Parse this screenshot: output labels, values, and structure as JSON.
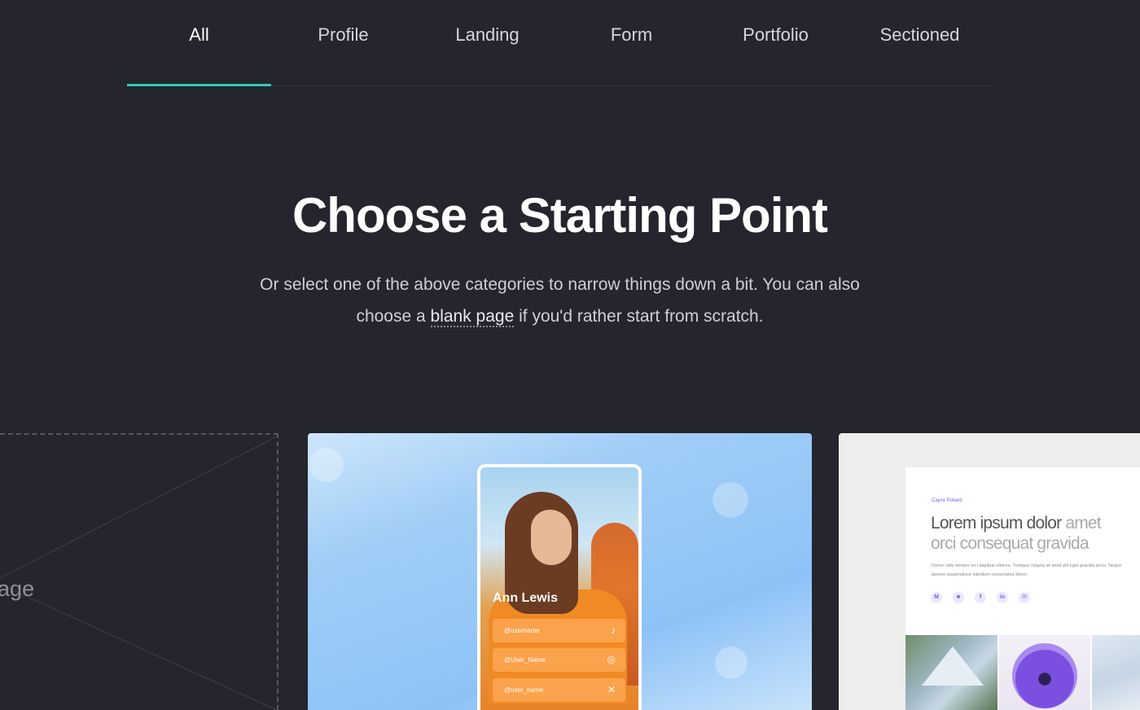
{
  "tabs": [
    {
      "label": "All",
      "active": true
    },
    {
      "label": "Profile",
      "active": false
    },
    {
      "label": "Landing",
      "active": false
    },
    {
      "label": "Form",
      "active": false
    },
    {
      "label": "Portfolio",
      "active": false
    },
    {
      "label": "Sectioned",
      "active": false
    }
  ],
  "accent_color": "#35c7b8",
  "hero": {
    "title": "Choose a Starting Point",
    "subtitle_before": "Or select one of the above categories to narrow things down a bit. You can also choose a ",
    "link_text": "blank page",
    "subtitle_after": " if you'd rather start from scratch."
  },
  "cards": {
    "blank": {
      "label": "ank Page"
    },
    "profile": {
      "name": "Ann Lewis",
      "links": [
        {
          "text": "@username",
          "icon": "tiktok-icon",
          "glyph": "♪"
        },
        {
          "text": "@User_Name",
          "icon": "instagram-icon",
          "glyph": "◎"
        },
        {
          "text": "@user_name",
          "icon": "x-icon",
          "glyph": "✕"
        }
      ]
    },
    "portfolio": {
      "author": "Cayce Pollard",
      "heading_dark": "Lorem ipsum dolor ",
      "heading_light_1": "amet",
      "heading_light_2": "orci consequat gravida",
      "body": "Donec odio tempor orci dapibus ultrices. Tristique magna sit amet elit eget gravida socis. Neque laoreet suspendisse interdum consectetur libero.",
      "socials": [
        {
          "icon": "medium-icon",
          "glyph": "M"
        },
        {
          "icon": "bookmark-icon",
          "glyph": "■"
        },
        {
          "icon": "facebook-icon",
          "glyph": "f"
        },
        {
          "icon": "linkedin-icon",
          "glyph": "in"
        },
        {
          "icon": "email-icon",
          "glyph": "✉"
        }
      ]
    }
  }
}
